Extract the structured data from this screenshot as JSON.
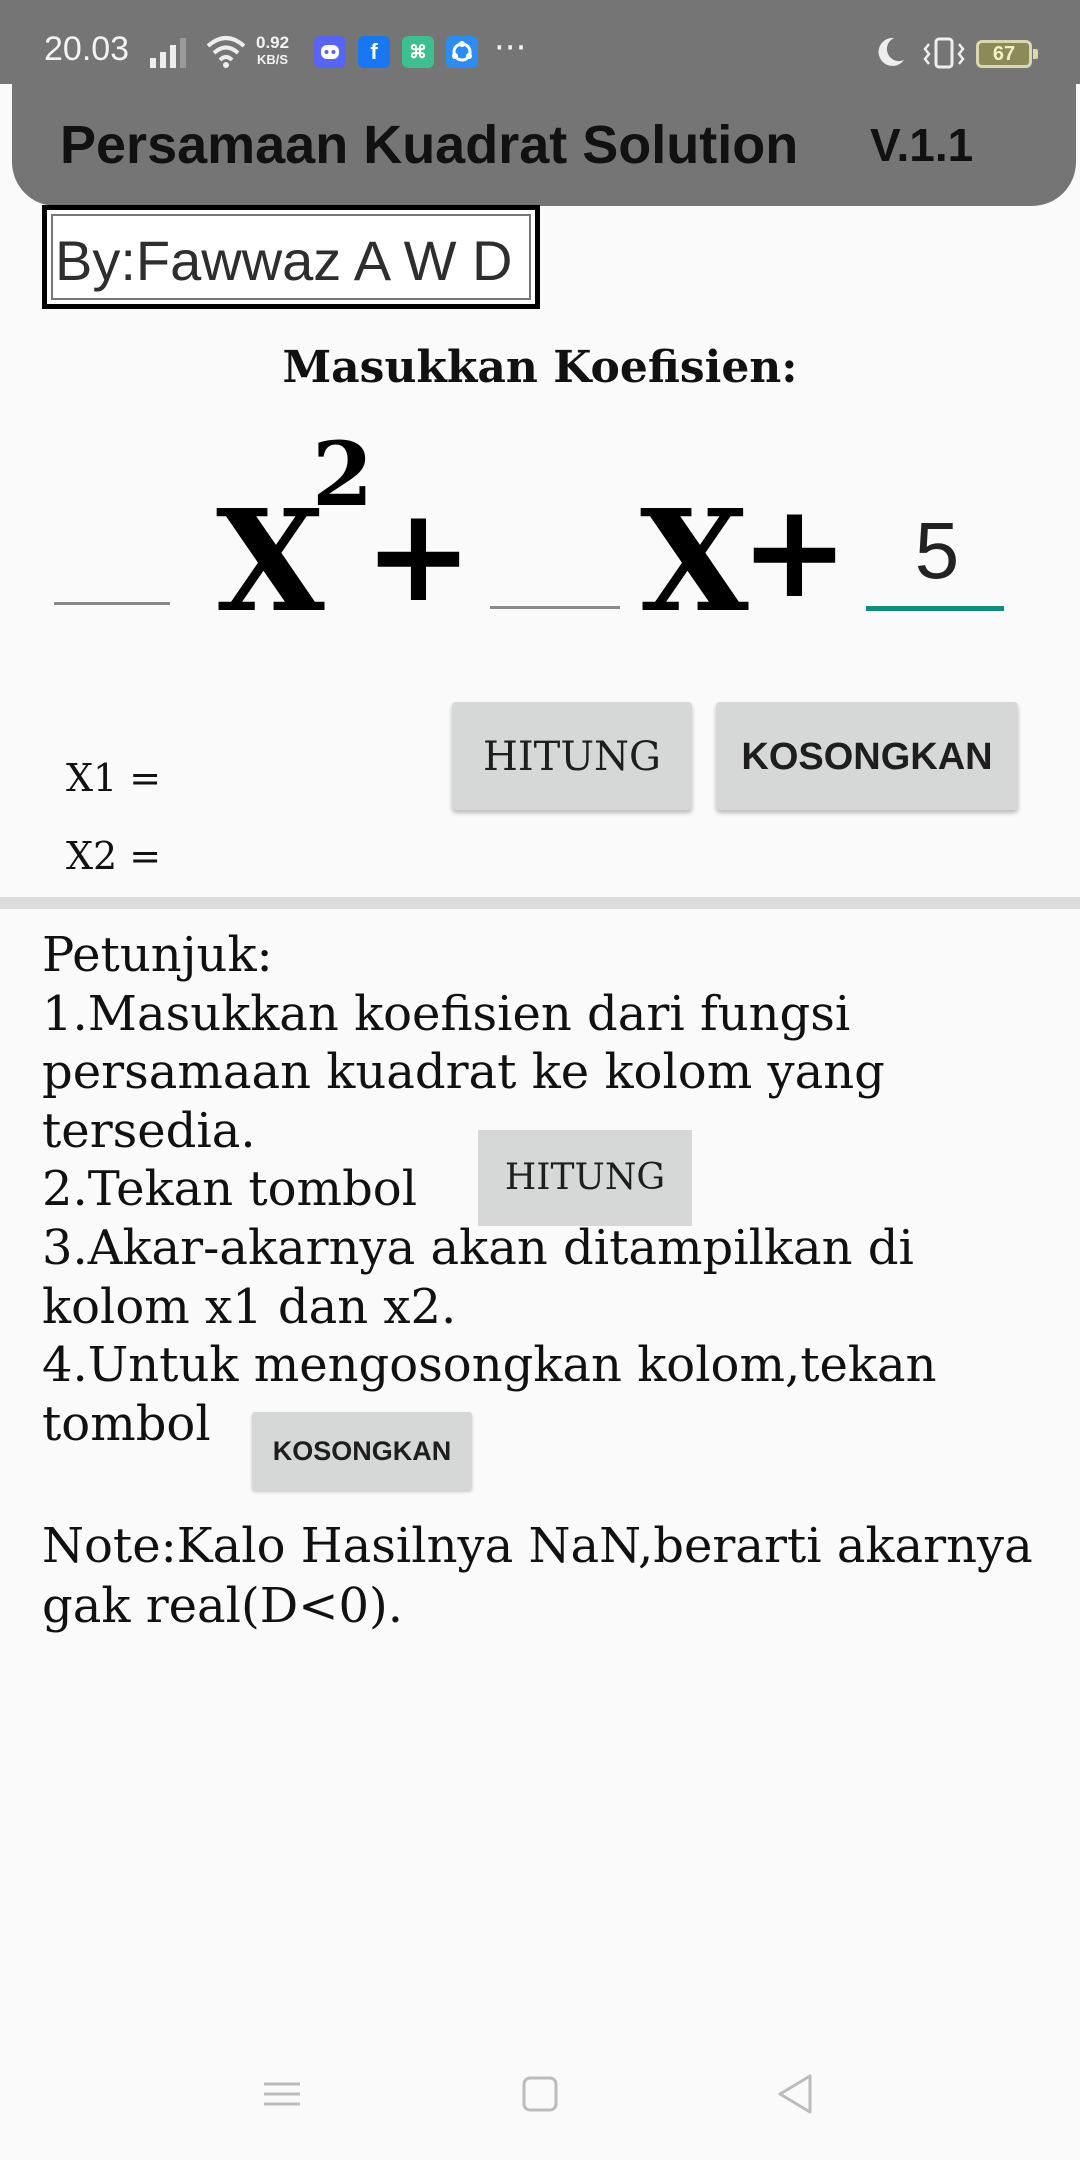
{
  "status_bar": {
    "time": "20.03",
    "net_speed_value": "0.92",
    "net_speed_unit": "KB/S",
    "apps": [
      {
        "icon": "discord-icon",
        "color": "#5865f2",
        "glyph": "d"
      },
      {
        "icon": "facebook-icon",
        "color": "#1877f2",
        "glyph": "f"
      },
      {
        "icon": "shop-app-icon",
        "color": "#3fbf8f",
        "glyph": "s"
      },
      {
        "icon": "sync-app-icon",
        "color": "#2d8cf0",
        "glyph": "c"
      }
    ],
    "more": "···",
    "battery": "67"
  },
  "app_bar": {
    "title": "Persamaan Kuadrat Solution",
    "version": "V.1.1"
  },
  "author": "By:Fawwaz A W D",
  "prompt": "Masukkan Koefisien:",
  "equation": {
    "var_x": "X",
    "exponent": "2",
    "plus": "+",
    "coef_a": "",
    "coef_b": "",
    "coef_c": "5"
  },
  "buttons": {
    "hitung": "HITUNG",
    "kosongkan": "KOSONGKAN"
  },
  "results": {
    "x1_label": "X1 =",
    "x1_value": "",
    "x2_label": "X2 =",
    "x2_value": ""
  },
  "instructions": {
    "heading": "Petunjuk:",
    "step1": "1.Masukkan koefisien dari fungsi persamaan kuadrat ke kolom yang tersedia.",
    "step2": "2.Tekan tombol",
    "step2_button": "HITUNG",
    "step3": "3.Akar-akarnya akan ditampilkan di kolom x1 dan x2.",
    "step4": "4.Untuk mengosongkan kolom,tekan tombol",
    "step4_button": "KOSONGKAN"
  },
  "note": "Note:Kalo Hasilnya NaN,berarti akarnya gak real(D<0).",
  "colors": {
    "bar_gray": "#757575",
    "focus_accent": "#128c7e",
    "button_gray": "#d6d7d7"
  }
}
